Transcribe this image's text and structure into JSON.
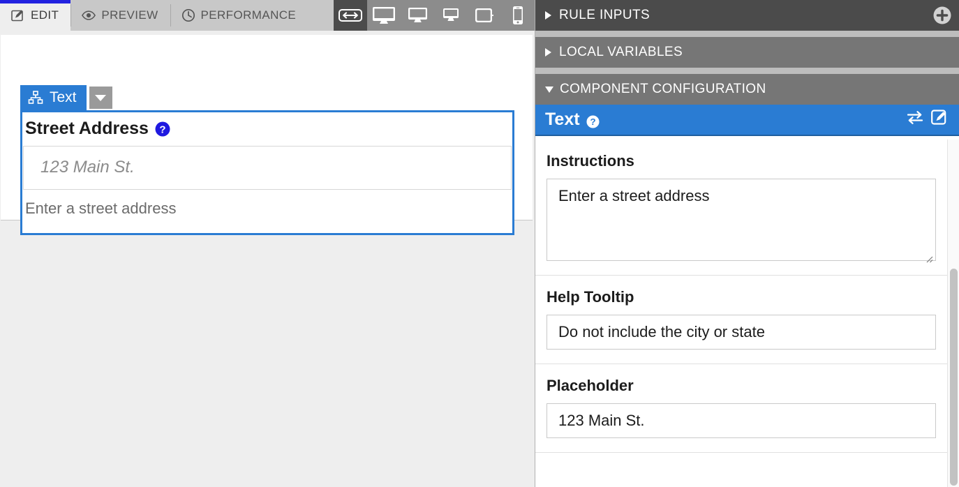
{
  "main_tabs": [
    {
      "label": "EDIT",
      "icon": "pencil-square-icon",
      "active": true
    },
    {
      "label": "PREVIEW",
      "icon": "eye-icon",
      "active": false
    },
    {
      "label": "PERFORMANCE",
      "icon": "clock-icon",
      "active": false
    }
  ],
  "device_buttons": [
    {
      "name": "responsive-width-icon",
      "selected": true
    },
    {
      "name": "desktop-large-icon",
      "selected": false
    },
    {
      "name": "desktop-medium-icon",
      "selected": false
    },
    {
      "name": "desktop-small-icon",
      "selected": false
    },
    {
      "name": "tablet-icon",
      "selected": false
    },
    {
      "name": "phone-icon",
      "selected": false
    }
  ],
  "canvas": {
    "component_chip": {
      "label": "Text",
      "icon": "sitemap-icon",
      "dropdown_icon": "caret-down-icon"
    },
    "component": {
      "label": "Street Address",
      "help_icon": "help-circle-icon",
      "placeholder": "123 Main St.",
      "instructions": "Enter a street address"
    }
  },
  "right_panel": {
    "sections": [
      {
        "label": "RULE INPUTS",
        "expanded": false,
        "style": "dark",
        "add_icon": "plus-circle-icon"
      },
      {
        "label": "LOCAL VARIABLES",
        "expanded": false,
        "style": "mid"
      },
      {
        "label": "COMPONENT CONFIGURATION",
        "expanded": true,
        "style": "mid"
      }
    ],
    "component_header": {
      "title": "Text",
      "help_icon": "help-circle-icon",
      "swap_icon": "swap-arrows-icon",
      "edit_icon": "pencil-square-icon"
    },
    "fields": [
      {
        "label": "Instructions",
        "value": "Enter a street address",
        "type": "textarea",
        "resize_icon": "resize-grip-icon"
      },
      {
        "label": "Help Tooltip",
        "value": "Do not include the city or state",
        "type": "text"
      },
      {
        "label": "Placeholder",
        "value": "123 Main St.",
        "type": "text"
      }
    ]
  },
  "colors": {
    "accent_blue": "#2a7cd3",
    "tab_active_bar": "#2222e0",
    "toolbar_gray": "#c8c8c8",
    "device_bar": "#8c8c8c",
    "section_dark": "#4b4b4b",
    "section_mid": "#767676",
    "canvas_bg": "#eeeeee"
  }
}
